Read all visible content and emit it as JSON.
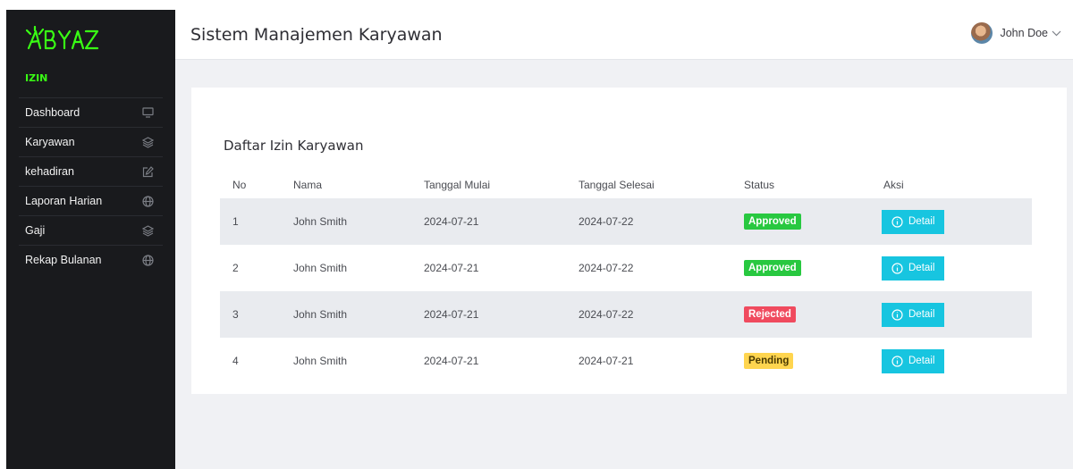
{
  "sidebar": {
    "logo_text": "ABYAZ",
    "section_label": "IZIN",
    "items": [
      {
        "label": "Dashboard",
        "icon": "monitor-icon"
      },
      {
        "label": "Karyawan",
        "icon": "layers-icon"
      },
      {
        "label": "kehadiran",
        "icon": "edit-icon"
      },
      {
        "label": "Laporan Harian",
        "icon": "globe-icon"
      },
      {
        "label": "Gaji",
        "icon": "layers-icon"
      },
      {
        "label": "Rekap Bulanan",
        "icon": "globe-icon"
      }
    ]
  },
  "header": {
    "title": "Sistem Manajemen Karyawan",
    "user_name": "John Doe"
  },
  "card": {
    "title": "Daftar Izin Karyawan"
  },
  "table": {
    "columns": [
      "No",
      "Nama",
      "Tanggal Mulai",
      "Tanggal Selesai",
      "Status",
      "Aksi"
    ],
    "rows": [
      {
        "no": "1",
        "nama": "John Smith",
        "mulai": "2024-07-21",
        "selesai": "2024-07-22",
        "status": "Approved",
        "aksi": "Detail"
      },
      {
        "no": "2",
        "nama": "John Smith",
        "mulai": "2024-07-21",
        "selesai": "2024-07-22",
        "status": "Approved",
        "aksi": "Detail"
      },
      {
        "no": "3",
        "nama": "John Smith",
        "mulai": "2024-07-21",
        "selesai": "2024-07-22",
        "status": "Rejected",
        "aksi": "Detail"
      },
      {
        "no": "4",
        "nama": "John Smith",
        "mulai": "2024-07-21",
        "selesai": "2024-07-21",
        "status": "Pending",
        "aksi": "Detail"
      }
    ]
  },
  "colors": {
    "sidebar_bg": "#191a1d",
    "accent_green": "#39ff14",
    "approved": "#28c840",
    "rejected": "#f04a5e",
    "pending": "#ffd54f",
    "detail_button": "#17c5e0"
  }
}
